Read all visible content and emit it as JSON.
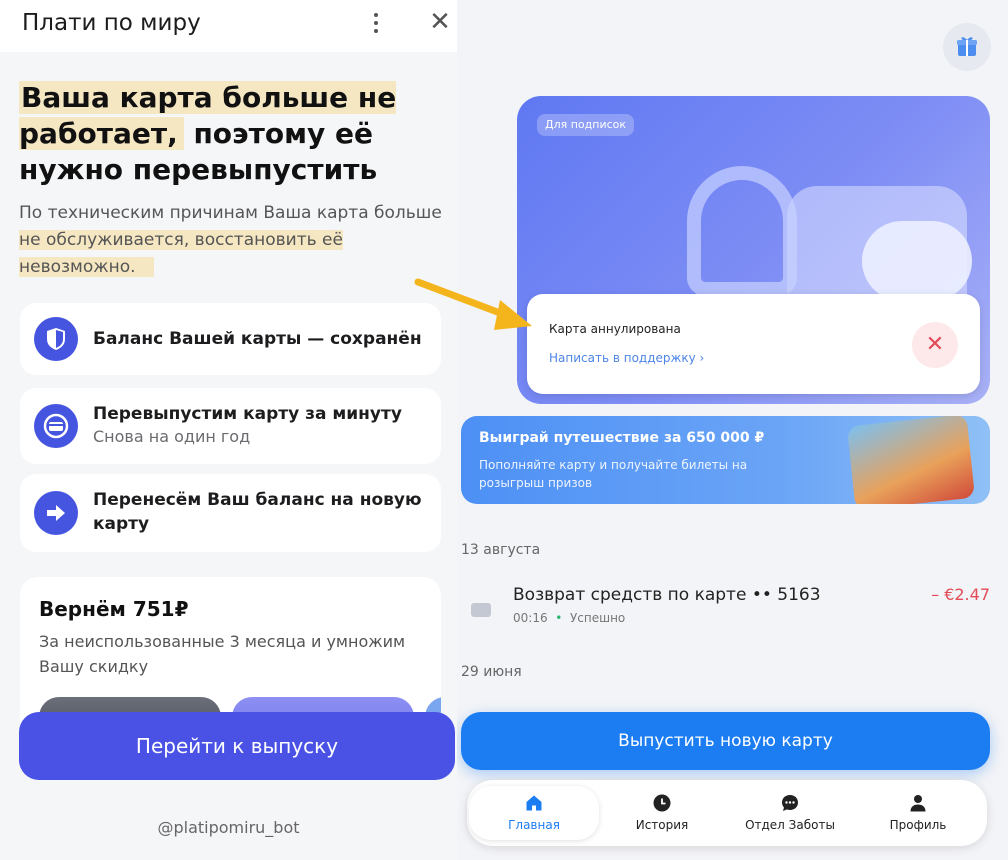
{
  "left": {
    "title": "Плати по миру",
    "headline_part1": "Ваша карта больше не работает,",
    "headline_part2": "поэтому её нужно перевыпустить",
    "subtitle_part1": "По техническим причинам Ваша карта больше",
    "subtitle_part2": "не обслуживается, восстановить её невозможно.",
    "features": [
      {
        "title": "Баланс Вашей карты — сохранён",
        "icon": "shield-icon"
      },
      {
        "title": "Перевыпустим карту за минуту",
        "subtitle": "Снова на один год",
        "icon": "card-refresh-icon"
      },
      {
        "title": "Перенесём Ваш баланс на новую карту",
        "icon": "arrow-right-icon"
      }
    ],
    "refund": {
      "title": "Вернём 751₽",
      "desc": "За неиспользованные 3 месяца и умножим Вашу скидку"
    },
    "go_button": "Перейти к выпуску",
    "watermark": "@platipomiru_bot"
  },
  "right": {
    "promo_tag": "Для подписок",
    "alert": {
      "title": "Карта аннулирована",
      "link": "Написать в поддержку ›"
    },
    "banner": {
      "title": "Выиграй путешествие за 650 000 ₽",
      "desc": "Пополняйте карту и получайте билеты на розыгрыш призов"
    },
    "dates": [
      "13 августа",
      "29 июня"
    ],
    "transactions": [
      {
        "name": "Возврат средств по карте •• 5163",
        "time": "00:16",
        "status": "Успешно",
        "amount": "– €2.47"
      }
    ],
    "new_card_button": "Выпустить новую карту",
    "tabs": [
      {
        "label": "Главная",
        "icon": "home-icon"
      },
      {
        "label": "История",
        "icon": "clock-icon"
      },
      {
        "label": "Отдел Заботы",
        "icon": "chat-icon"
      },
      {
        "label": "Профиль",
        "icon": "profile-icon"
      }
    ],
    "colors": {
      "accent": "#1c7df2",
      "left_accent": "#4a52e6",
      "danger": "#e24b57"
    }
  }
}
